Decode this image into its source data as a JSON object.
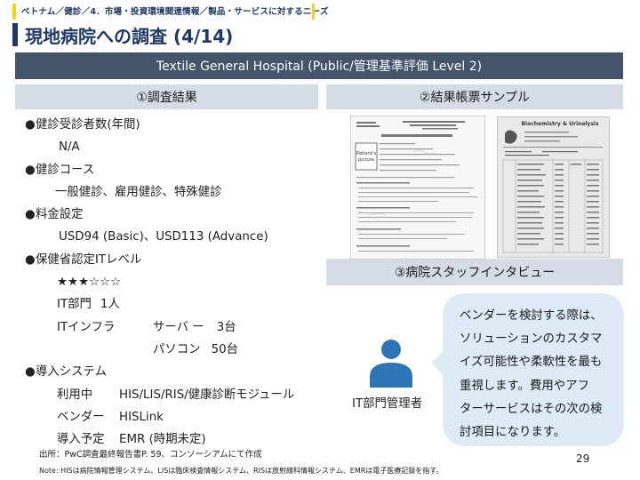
{
  "breadcrumb": "ベトナム／健診／4．市場・投資環境関連情報／製品・サービスに対するニーズ",
  "page_title": "現地病院への調査 (4/14)",
  "hospital_banner": "Textile General Hospital (Public/管理基準評価 Level 2)",
  "sections": {
    "results": "①調査結果",
    "samples": "②結果帳票サンプル",
    "interview": "③病院スタッフインタビュー"
  },
  "results": {
    "bullet": "●",
    "checkup_count_label": "健診受診者数(年間)",
    "checkup_count_value": "N/A",
    "course_label": "健診コース",
    "course_value": "一般健診、雇用健診、特殊健診",
    "fee_label": "料金設定",
    "fee_value": "USD94 (Basic)、USD113 (Advance)",
    "it_level_label": "保健省認定ITレベル",
    "it_level_stars": "★★★☆☆☆",
    "it_dept_label": "IT部門",
    "it_dept_value": "1人",
    "infra_label": "ITインフラ",
    "server_label": "サーバ ー",
    "server_value": "3台",
    "pc_label": "パソコン",
    "pc_value": "50台",
    "system_label": "導入システム",
    "in_use_label": "利用中",
    "in_use_value": "HIS/LIS/RIS/健康診断モジュール",
    "vendor_label": "ベンダー",
    "vendor_value": "HISLink",
    "planned_label": "導入予定",
    "planned_value": "EMR (時期未定)"
  },
  "sample_docs": {
    "doc1_photo_label_1": "Patient's",
    "doc1_photo_label_2": "picture",
    "doc2_title": "Biochemistry & Urinalysis"
  },
  "interview": {
    "staff_label": "IT部門管理者",
    "quote_lines": [
      "ベンダーを検討する際は、",
      "ソリューションのカスタマ",
      "イズ可能性や柔軟性を最も",
      "重視します。費用やアフ",
      "ターサービスはその次の検",
      "討項目になります。"
    ]
  },
  "footer": {
    "source": "出所：PwC調査最終報告書P. 59、コンソーシアムにて作成",
    "note": "Note: HISは病院情報管理システム、LISは臨床検査情報システム、RISは放射線科情報システム、EMRは電子医療記録を指す。",
    "page_number": "29"
  },
  "colors": {
    "navy": "#1f3864",
    "banner": "#44546a",
    "section_head": "#d6dce5",
    "accent_yellow": "#f2d21d",
    "bubble": "#deebf7",
    "avatar": "#2e75b6"
  },
  "icons": {
    "avatar": "person-icon"
  }
}
